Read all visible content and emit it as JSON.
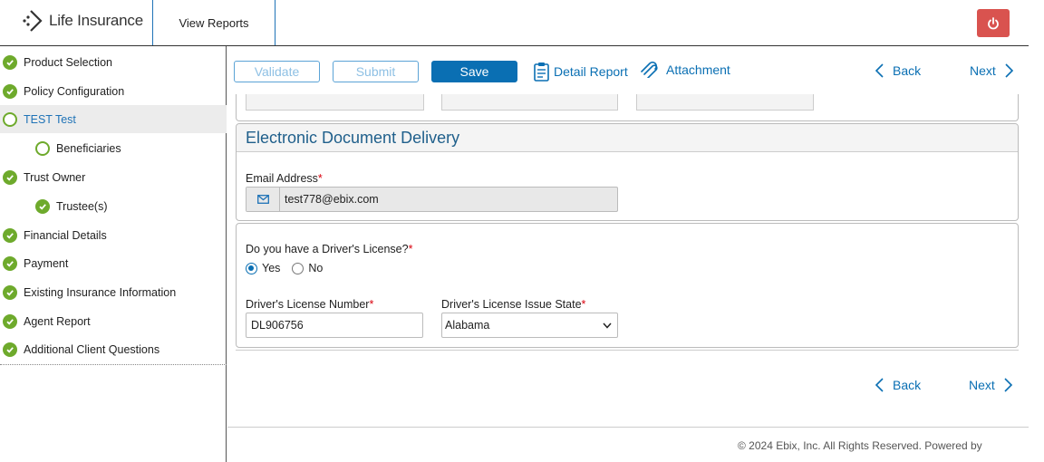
{
  "header": {
    "app_name": "Life Insurance",
    "view_reports": "View Reports",
    "power_icon": "power-icon",
    "power_color": "#d9534f"
  },
  "sidebar": {
    "items": [
      {
        "label": "Product Selection",
        "status": "complete"
      },
      {
        "label": "Policy Configuration",
        "status": "complete"
      },
      {
        "label": "TEST Test",
        "status": "incomplete",
        "active": true
      },
      {
        "label": "Beneficiaries",
        "status": "incomplete",
        "indent": true
      },
      {
        "label": "Trust Owner",
        "status": "complete"
      },
      {
        "label": "Trustee(s)",
        "status": "complete",
        "indent": true
      },
      {
        "label": "Financial Details",
        "status": "complete"
      },
      {
        "label": "Payment",
        "status": "complete"
      },
      {
        "label": "Existing Insurance Information",
        "status": "complete"
      },
      {
        "label": "Agent Report",
        "status": "complete"
      },
      {
        "label": "Additional Client Questions",
        "status": "complete"
      }
    ]
  },
  "toolbar": {
    "validate": "Validate",
    "submit": "Submit",
    "save": "Save",
    "detail_report": "Detail Report",
    "attachment": "Attachment",
    "back": "Back",
    "next": "Next"
  },
  "edd": {
    "title": "Electronic Document Delivery",
    "email_label": "Email Address",
    "email_value": "test778@ebix.com"
  },
  "license": {
    "question": "Do you have a Driver's License?",
    "yes": "Yes",
    "no": "No",
    "selected": "Yes",
    "number_label": "Driver's License Number",
    "number_value": "DL906756",
    "state_label": "Driver's License Issue State",
    "state_value": "Alabama"
  },
  "bottom_nav": {
    "back": "Back",
    "next": "Next"
  },
  "footer": {
    "text": "© 2024 Ebix, Inc. All Rights Reserved. Powered by"
  },
  "colors": {
    "accent": "#0a6fb3",
    "complete": "#6eaa2c",
    "required": "#d9000d"
  }
}
